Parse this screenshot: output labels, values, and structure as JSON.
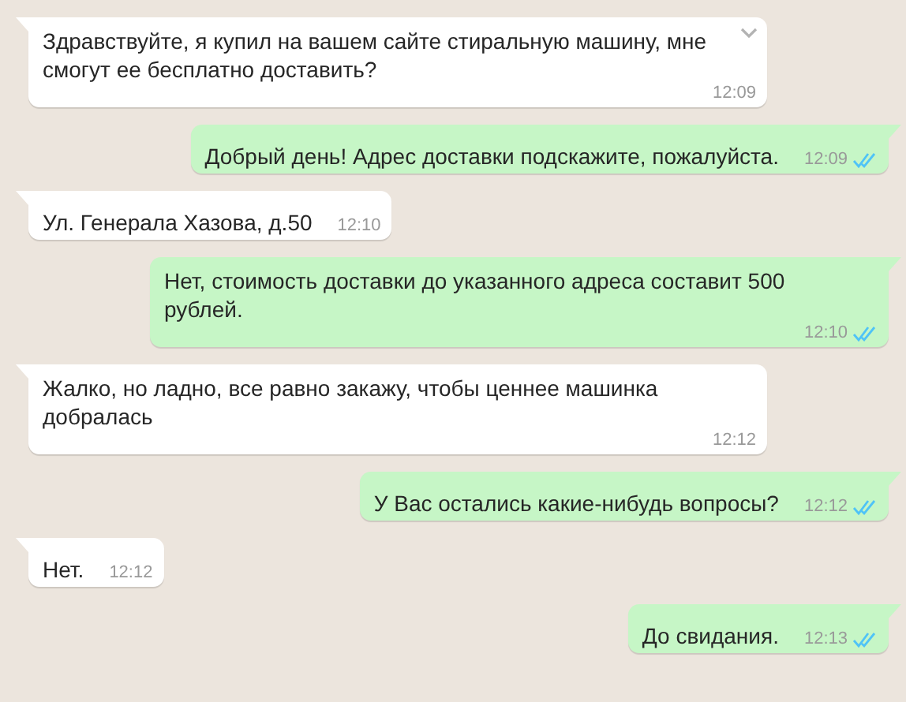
{
  "messages": [
    {
      "kind": "incoming",
      "text": "Здравствуйте, я купил на вашем сайте стиральную машину, мне смогут ее бесплатно доставить?",
      "time": "12:09",
      "menu_shown": true
    },
    {
      "kind": "outgoing",
      "text": "Добрый день! Адрес доставки подскажите, пожалуйста.",
      "time": "12:09",
      "menu_shown": false,
      "read": true
    },
    {
      "kind": "incoming",
      "text": "Ул. Генерала Хазова, д.50",
      "time": "12:10",
      "menu_shown": false
    },
    {
      "kind": "outgoing",
      "text": "Нет, стоимость доставки до указанного адреса составит 500 рублей.",
      "time": "12:10",
      "menu_shown": false,
      "read": true
    },
    {
      "kind": "incoming",
      "text": "Жалко, но ладно, все равно закажу, чтобы ценнее машинка добралась",
      "time": "12:12",
      "menu_shown": false
    },
    {
      "kind": "outgoing",
      "text": "У Вас остались какие-нибудь вопросы?",
      "time": "12:12",
      "menu_shown": false,
      "read": true
    },
    {
      "kind": "incoming",
      "text": "Нет.",
      "time": "12:12",
      "menu_shown": false
    },
    {
      "kind": "outgoing",
      "text": "До свидания.",
      "time": "12:13",
      "menu_shown": false,
      "read": true
    }
  ]
}
